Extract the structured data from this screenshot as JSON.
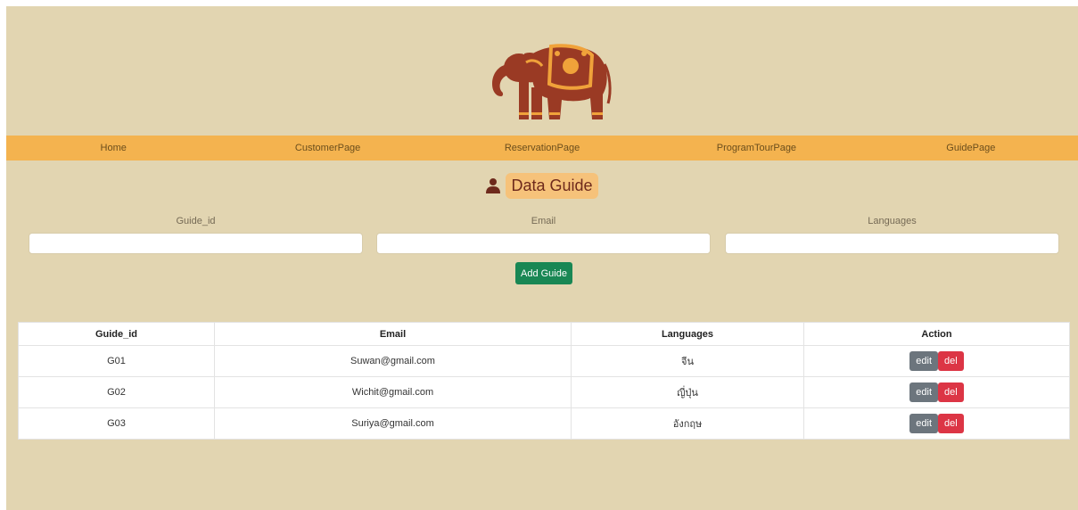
{
  "colors": {
    "background": "#e2d5b1",
    "nav": "#f4b34f",
    "title_badge": "#f6c27a",
    "elephant": "#9a3a24",
    "elephant_ornament": "#f0a23a",
    "add_button": "#198754",
    "edit_button": "#6c757d",
    "del_button": "#dc3545"
  },
  "logo": {
    "icon": "elephant-logo-icon"
  },
  "nav": {
    "items": [
      {
        "label": "Home"
      },
      {
        "label": "CustomerPage"
      },
      {
        "label": "ReservationPage"
      },
      {
        "label": "ProgramTourPage"
      },
      {
        "label": "GuidePage"
      }
    ]
  },
  "header": {
    "title": "Data Guide",
    "icon": "user-icon"
  },
  "form": {
    "fields": [
      {
        "label": "Guide_id",
        "value": ""
      },
      {
        "label": "Email",
        "value": ""
      },
      {
        "label": "Languages",
        "value": ""
      }
    ],
    "add_label": "Add Guide"
  },
  "table": {
    "columns": [
      "Guide_id",
      "Email",
      "Languages",
      "Action"
    ],
    "rows": [
      {
        "id": "G01",
        "email": "Suwan@gmail.com",
        "language": "จีน"
      },
      {
        "id": "G02",
        "email": "Wichit@gmail.com",
        "language": "ญี่ปุ่น"
      },
      {
        "id": "G03",
        "email": "Suriya@gmail.com",
        "language": "อังกฤษ"
      }
    ],
    "edit_label": "edit",
    "del_label": "del"
  }
}
